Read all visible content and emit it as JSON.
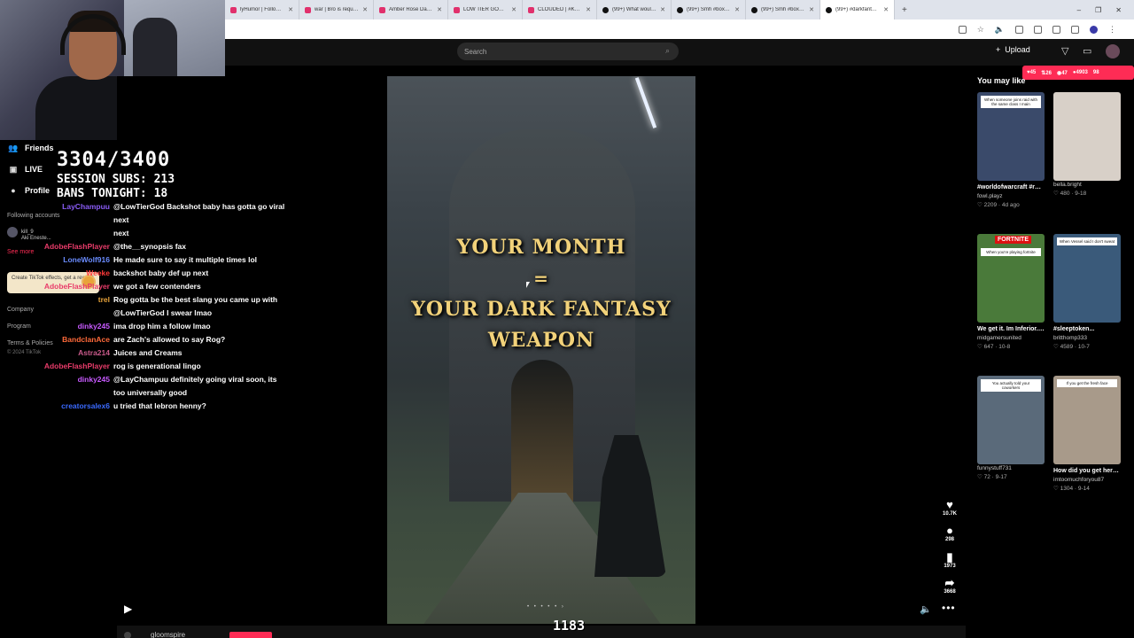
{
  "browser": {
    "tabs": [
      {
        "title": "lyHumor | Follow me",
        "kind": "ig"
      },
      {
        "title": "war | Bro is requesting his",
        "kind": "ig"
      },
      {
        "title": "Amber Rose Dawson | W",
        "kind": "ig"
      },
      {
        "title": "LOW TIER GOD (@dalaus",
        "kind": "ig"
      },
      {
        "title": "CLOUDED | #KevinHart to",
        "kind": "ig"
      },
      {
        "title": "(99+) What would you rat",
        "kind": "tt"
      },
      {
        "title": "(99+) Smh #boxing #",
        "kind": "tt"
      },
      {
        "title": "(99+) Smh #boxing #",
        "kind": "tt"
      },
      {
        "title": "(99+) #darkfantasy #p",
        "kind": "tt"
      }
    ],
    "active_tab_index": 8,
    "new_tab": "+",
    "win": [
      "–",
      "❐",
      "✕"
    ]
  },
  "overlay": {
    "subs_goal": "3304/3400",
    "session_subs": "SESSION SUBS: 213",
    "bans": "BANS TONIGHT: 18",
    "counter": "1183"
  },
  "chat": [
    {
      "user": "LayChampuu",
      "color": "#8a5cf6",
      "text": "@LowTierGod Backshot baby has gotta go viral next"
    },
    {
      "user": "",
      "color": "#fff",
      "text": "next"
    },
    {
      "user": "AdobeFlashPlayer",
      "color": "#e83c6a",
      "text": "@the__synopsis fax"
    },
    {
      "user": "LoneWolf916",
      "color": "#6a8cff",
      "text": "He made sure to say it multiple times lol"
    },
    {
      "user": "Weeke",
      "color": "#ff3a3a",
      "text": "backshot baby def up next"
    },
    {
      "user": "AdobeFlashPlayer",
      "color": "#e83c6a",
      "text": "we got a few contenders"
    },
    {
      "user": "trel",
      "color": "#e8a33a",
      "text": "Rog gotta be the best slang you came up with"
    },
    {
      "user": "",
      "color": "#fff",
      "text": "@LowTierGod I swear lmao"
    },
    {
      "user": "dinky245",
      "color": "#c85aff",
      "text": "ima drop him a follow lmao"
    },
    {
      "user": "BandclanAce",
      "color": "#ff6a3a",
      "text": "are Zach's allowed to say Rog?"
    },
    {
      "user": "Astra214",
      "color": "#c85a8a",
      "text": "Juices and Creams"
    },
    {
      "user": "AdobeFlashPlayer",
      "color": "#e83c6a",
      "text": "rog is generational lingo"
    },
    {
      "user": "dinky245",
      "color": "#c85aff",
      "text": "@LayChampuu definitely going viral soon, its"
    },
    {
      "user": "",
      "color": "#fff",
      "text": "too universally good"
    },
    {
      "user": "creatorsalex6",
      "color": "#3a6aff",
      "text": "u tried that lebron henny?"
    }
  ],
  "sidebar": {
    "nav": [
      {
        "label": "Friends",
        "icon": "friends-icon",
        "glyph": "👥"
      },
      {
        "label": "LIVE",
        "icon": "live-icon",
        "glyph": "▣"
      },
      {
        "label": "Profile",
        "icon": "profile-icon",
        "glyph": "●"
      }
    ],
    "following_heading": "Following accounts",
    "accounts": [
      "kill_9",
      "Aki Eneste..."
    ],
    "see_more": "See more",
    "effects_promo": "Create TikTok effects, get a reward",
    "footer": [
      "Company",
      "Program",
      "Terms & Policies"
    ],
    "copyright": "© 2024 TikTok"
  },
  "topnav": {
    "search_placeholder": "Search",
    "upload_label": "Upload"
  },
  "stats": {
    "hearts": "45",
    "reposts": "26",
    "viewers": "47",
    "followers": "4903",
    "other": "98"
  },
  "video": {
    "line1": "YOUR MONTH",
    "line2": "=",
    "line3": "YOUR DARK FANTASY",
    "line4": "WEAPON",
    "dots": "• • • • • ›"
  },
  "actions": [
    {
      "name": "like",
      "glyph": "♥",
      "count": "10.7K"
    },
    {
      "name": "comment",
      "glyph": "💬",
      "count": "298"
    },
    {
      "name": "save",
      "glyph": "🔖",
      "count": "1973"
    },
    {
      "name": "share",
      "glyph": "➦",
      "count": "3668"
    }
  ],
  "right": {
    "heading": "You may like",
    "recs": [
      {
        "title": "#worldofwarcraft #rogue",
        "user": "fowl.playz",
        "meta": "2209 · 4d ago",
        "caption": "When someone joins raid with the same class I main",
        "bg": "#3a4a6a"
      },
      {
        "title": "",
        "user": "bella.bright",
        "meta": "480 · 9-18",
        "caption": "",
        "bg": "#d8d0c8"
      },
      {
        "title": "We get it. Im Inferior. Lemme play. Go...",
        "user": "midgamersunited",
        "meta": "647 · 10-8",
        "caption": "When you're playing fortnite",
        "bg": "#4a7a3a",
        "badge": "FORTNITE"
      },
      {
        "title": "#sleeptoken...",
        "user": "britthomp333",
        "meta": "4589 · 10-7",
        "caption": "When Vessel said I don't sweat",
        "bg": "#3a5a7a"
      },
      {
        "title": "",
        "user": "funnystuff731",
        "meta": "72 · 9-17",
        "caption": "You actually told your coworkers",
        "bg": "#5a6a7a"
      },
      {
        "title": "How did you get here? #fyp...",
        "user": "imtoomuchforyou87",
        "meta": "1304 · 9-14",
        "caption": "If you get the fresh face",
        "bg": "#a89a8a"
      }
    ]
  },
  "bottom": {
    "user": "gloomspire"
  }
}
